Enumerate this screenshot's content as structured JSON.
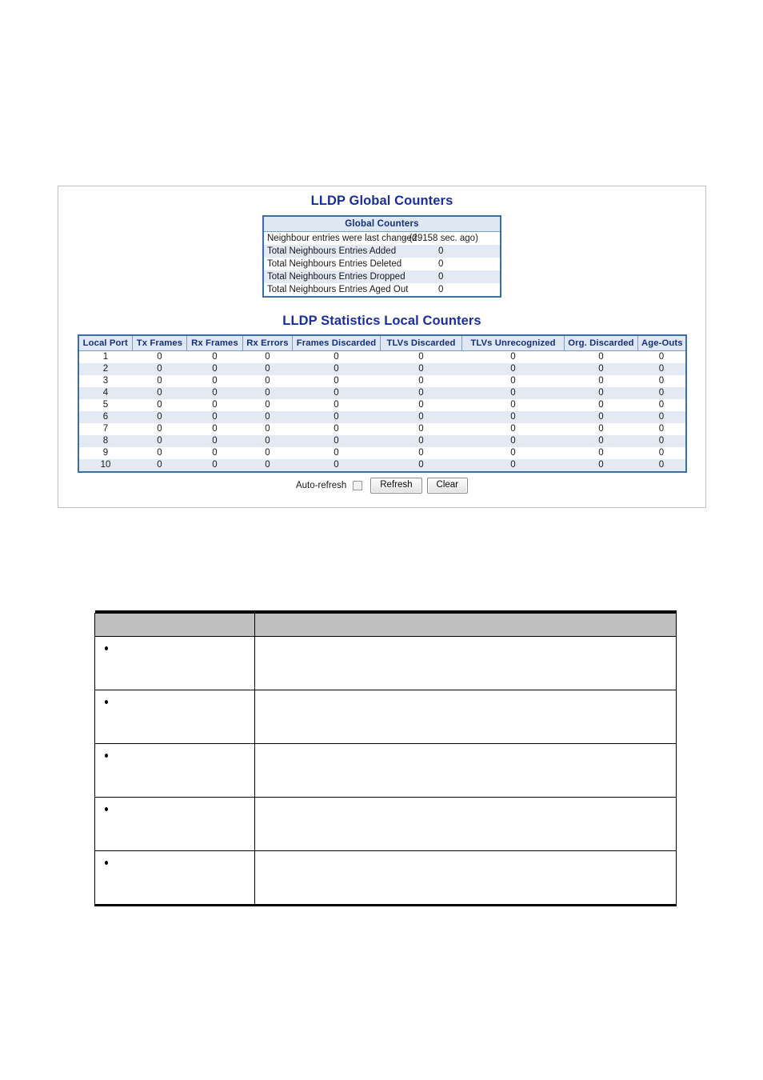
{
  "screenshot": {
    "global_section": {
      "title": "LLDP Global Counters",
      "table": {
        "header": "Global Counters",
        "rows": [
          {
            "label": "Neighbour entries were last changed",
            "value": "- (29158 sec. ago)"
          },
          {
            "label": "Total Neighbours Entries Added",
            "value": "0"
          },
          {
            "label": "Total Neighbours Entries Deleted",
            "value": "0"
          },
          {
            "label": "Total Neighbours Entries Dropped",
            "value": "0"
          },
          {
            "label": "Total Neighbours Entries Aged Out",
            "value": "0"
          }
        ]
      }
    },
    "stats_section": {
      "title": "LLDP Statistics Local Counters",
      "columns": [
        "Local Port",
        "Tx Frames",
        "Rx Frames",
        "Rx Errors",
        "Frames Discarded",
        "TLVs Discarded",
        "TLVs Unrecognized",
        "Org. Discarded",
        "Age-Outs"
      ],
      "rows": [
        [
          "1",
          "0",
          "0",
          "0",
          "0",
          "0",
          "0",
          "0",
          "0"
        ],
        [
          "2",
          "0",
          "0",
          "0",
          "0",
          "0",
          "0",
          "0",
          "0"
        ],
        [
          "3",
          "0",
          "0",
          "0",
          "0",
          "0",
          "0",
          "0",
          "0"
        ],
        [
          "4",
          "0",
          "0",
          "0",
          "0",
          "0",
          "0",
          "0",
          "0"
        ],
        [
          "5",
          "0",
          "0",
          "0",
          "0",
          "0",
          "0",
          "0",
          "0"
        ],
        [
          "6",
          "0",
          "0",
          "0",
          "0",
          "0",
          "0",
          "0",
          "0"
        ],
        [
          "7",
          "0",
          "0",
          "0",
          "0",
          "0",
          "0",
          "0",
          "0"
        ],
        [
          "8",
          "0",
          "0",
          "0",
          "0",
          "0",
          "0",
          "0",
          "0"
        ],
        [
          "9",
          "0",
          "0",
          "0",
          "0",
          "0",
          "0",
          "0",
          "0"
        ],
        [
          "10",
          "0",
          "0",
          "0",
          "0",
          "0",
          "0",
          "0",
          "0"
        ]
      ]
    },
    "controls": {
      "auto_refresh_label": "Auto-refresh",
      "auto_refresh_checked": false,
      "refresh_label": "Refresh",
      "clear_label": "Clear"
    },
    "colors": {
      "title_blue": "#1a2f9d",
      "table_border_blue": "#3a6ea5",
      "header_fill_blue": "#dfe7f2",
      "row_alt_blue": "#e3eaf4",
      "panel_border_gray": "#c0c0c0"
    }
  },
  "doc_table": {
    "header": {
      "col_a": "",
      "col_b": ""
    },
    "rows": [
      {
        "col_a": "",
        "col_b": ""
      },
      {
        "col_a": "",
        "col_b": ""
      },
      {
        "col_a": "",
        "col_b": ""
      },
      {
        "col_a": "",
        "col_b": ""
      },
      {
        "col_a": "",
        "col_b": ""
      }
    ]
  }
}
